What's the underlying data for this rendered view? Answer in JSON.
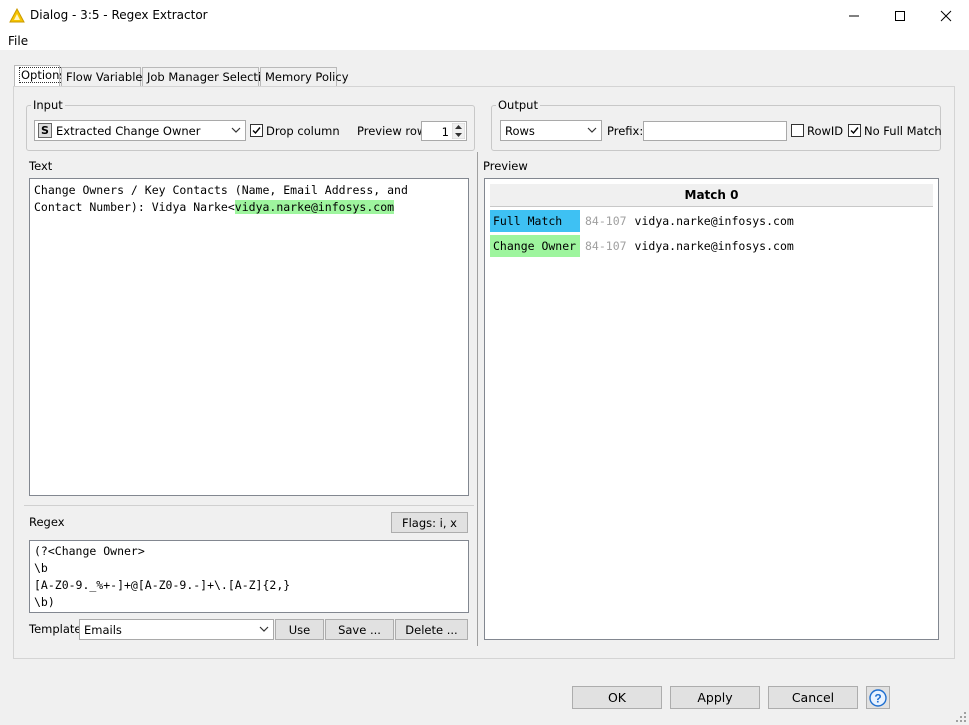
{
  "window": {
    "title": "Dialog - 3:5 - Regex Extractor"
  },
  "menu": {
    "file": "File"
  },
  "tabs": [
    "Options",
    "Flow Variables",
    "Job Manager Selection",
    "Memory Policy"
  ],
  "input": {
    "group_label": "Input",
    "column_type": "S",
    "column": "Extracted Change Owner",
    "drop_column_label": "Drop column",
    "drop_column_checked": true,
    "preview_row_label": "Preview row:",
    "preview_row_value": "1"
  },
  "output": {
    "group_label": "Output",
    "mode": "Rows",
    "prefix_label": "Prefix:",
    "prefix_value": "",
    "rowid_label": "RowID",
    "rowid_checked": false,
    "no_full_match_label": "No Full Match",
    "no_full_match_checked": true
  },
  "text": {
    "label": "Text",
    "line1": "Change Owners / Key Contacts (Name, Email Address, and",
    "line2_prefix": "Contact Number): Vidya Narke<",
    "line2_match": "vidya.narke@infosys.com"
  },
  "regex": {
    "label": "Regex",
    "flags_label": "Flags: i, x",
    "lines": [
      "(?<Change Owner>",
      "\\b",
      "[A-Z0-9._%+-]+@[A-Z0-9.-]+\\.[A-Z]{2,}",
      "\\b)"
    ]
  },
  "template": {
    "label": "Template",
    "selected": "Emails",
    "use_label": "Use",
    "save_label": "Save ...",
    "delete_label": "Delete ..."
  },
  "preview": {
    "label": "Preview",
    "header": "Match 0",
    "rows": [
      {
        "group": "Full Match",
        "range": "84-107",
        "value": "vidya.narke@infosys.com",
        "color": "#3ec1f3"
      },
      {
        "group": "Change Owner",
        "range": "84-107",
        "value": "vidya.narke@infosys.com",
        "color": "#9ef59e"
      }
    ]
  },
  "buttons": {
    "ok": "OK",
    "apply": "Apply",
    "cancel": "Cancel",
    "help": "?"
  }
}
